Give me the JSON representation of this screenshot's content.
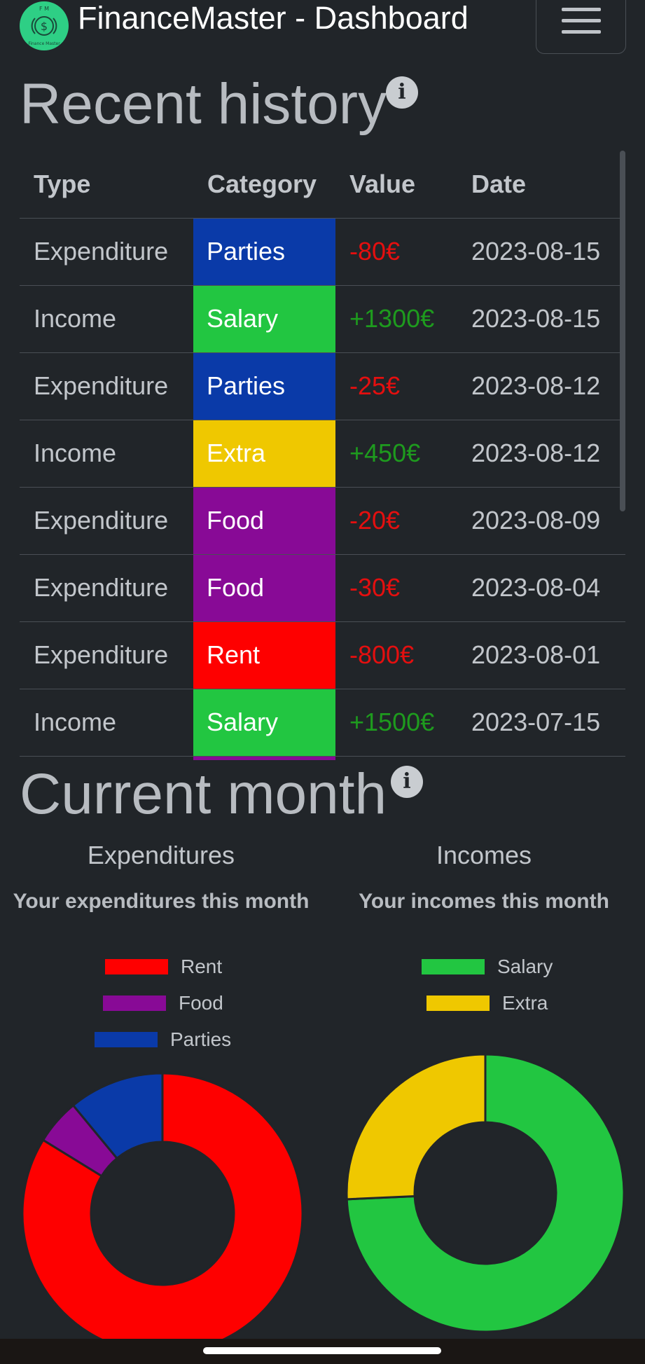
{
  "navbar": {
    "brand": "FinanceMaster - Dashboard",
    "logo_icon": "finance-master-logo",
    "logo_text_top": "F M",
    "logo_text_bottom": "Finance Master",
    "menu_icon": "hamburger-icon"
  },
  "history": {
    "title": "Recent history",
    "info_icon": "info-icon",
    "columns": [
      "Type",
      "Category",
      "Value",
      "Date"
    ],
    "rows": [
      {
        "type": "Expenditure",
        "category": "Parties",
        "value": "-80€",
        "date": "2023-08-15"
      },
      {
        "type": "Income",
        "category": "Salary",
        "value": "+1300€",
        "date": "2023-08-15"
      },
      {
        "type": "Expenditure",
        "category": "Parties",
        "value": "-25€",
        "date": "2023-08-12"
      },
      {
        "type": "Income",
        "category": "Extra",
        "value": "+450€",
        "date": "2023-08-12"
      },
      {
        "type": "Expenditure",
        "category": "Food",
        "value": "-20€",
        "date": "2023-08-09"
      },
      {
        "type": "Expenditure",
        "category": "Food",
        "value": "-30€",
        "date": "2023-08-04"
      },
      {
        "type": "Expenditure",
        "category": "Rent",
        "value": "-800€",
        "date": "2023-08-01"
      },
      {
        "type": "Income",
        "category": "Salary",
        "value": "+1500€",
        "date": "2023-07-15"
      },
      {
        "type": "",
        "category": "",
        "value": "",
        "date": ""
      }
    ]
  },
  "category_colors": {
    "Parties": "#0a3aa8",
    "Salary": "#22c641",
    "Extra": "#efc800",
    "Food": "#880a96",
    "Rent": "#fe0000"
  },
  "value_colors": {
    "negative": "#e40f0f",
    "positive": "#1e9b1e"
  },
  "current_month": {
    "title": "Current month",
    "info_icon": "info-icon"
  },
  "chart_data": [
    {
      "type": "pie",
      "title": "Expenditures",
      "subtitle": "Your expenditures this month",
      "categories": [
        "Rent",
        "Food",
        "Parties"
      ],
      "values": [
        800,
        50,
        105
      ],
      "colors": [
        "#fe0000",
        "#880a96",
        "#0a3aa8"
      ],
      "legend_position": "top"
    },
    {
      "type": "pie",
      "title": "Incomes",
      "subtitle": "Your incomes this month",
      "categories": [
        "Salary",
        "Extra"
      ],
      "values": [
        1300,
        450
      ],
      "colors": [
        "#22c641",
        "#efc800"
      ],
      "legend_position": "top"
    }
  ]
}
